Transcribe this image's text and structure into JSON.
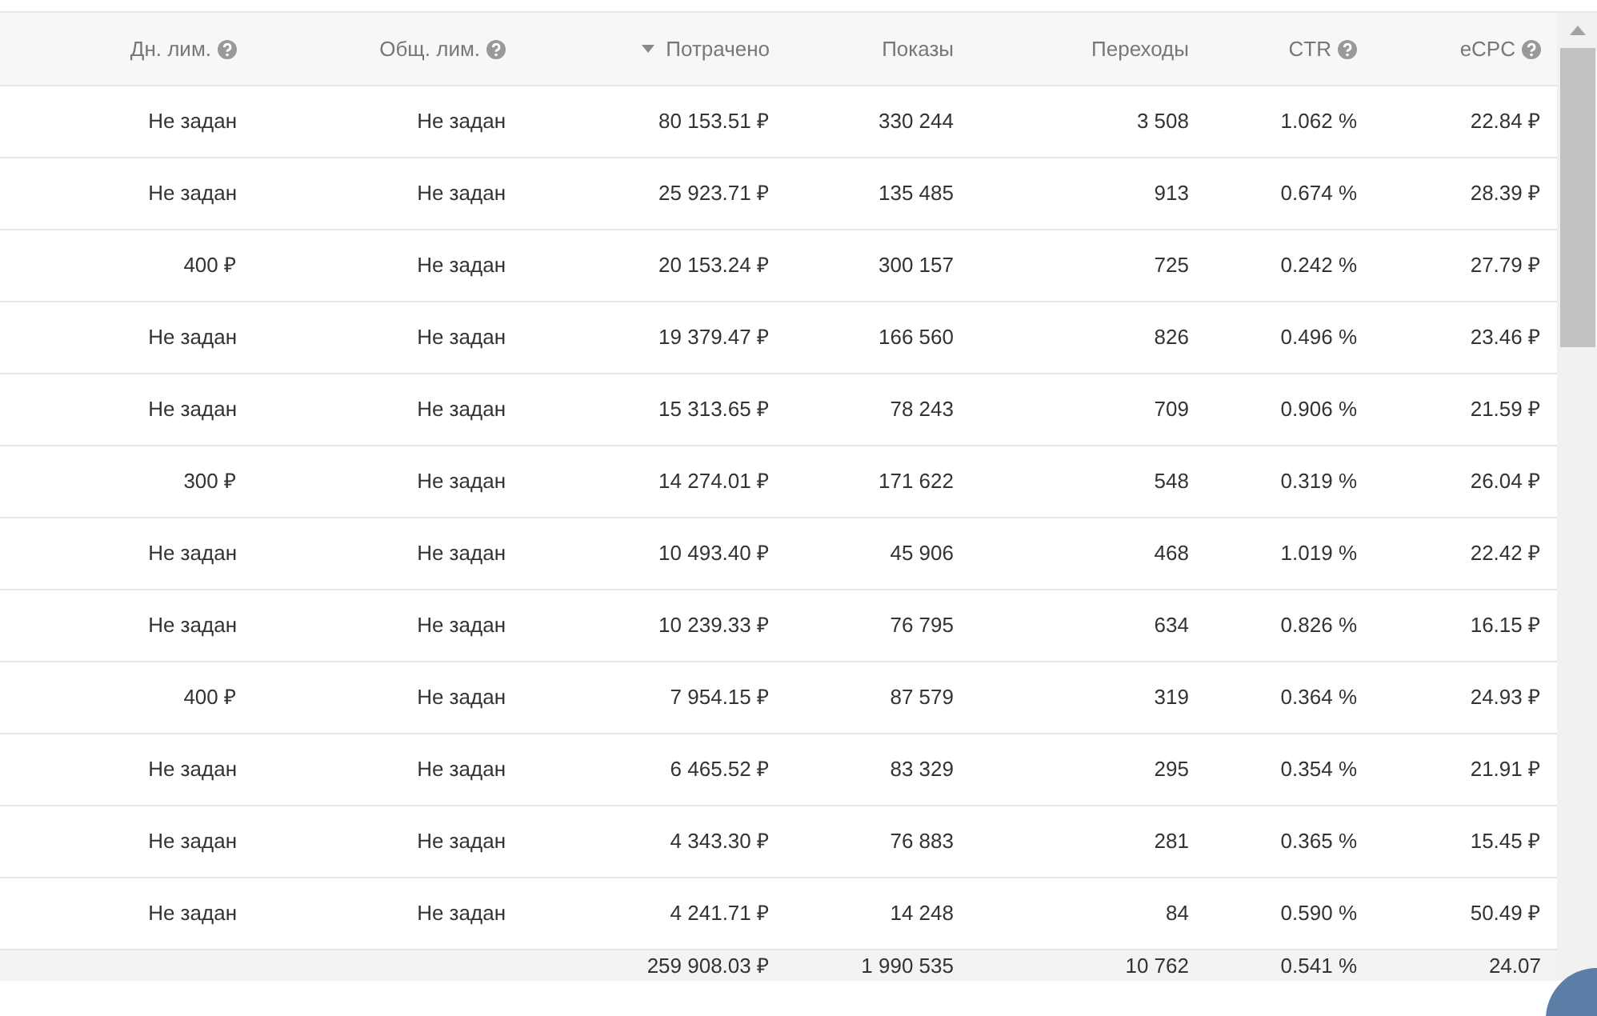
{
  "table": {
    "columns": [
      {
        "label": "Дн. лим.",
        "help": true,
        "sorted": false
      },
      {
        "label": "Общ. лим.",
        "help": true,
        "sorted": false
      },
      {
        "label": "Потрачено",
        "help": false,
        "sorted": true
      },
      {
        "label": "Показы",
        "help": false,
        "sorted": false
      },
      {
        "label": "Переходы",
        "help": false,
        "sorted": false
      },
      {
        "label": "CTR",
        "help": true,
        "sorted": false
      },
      {
        "label": "eCPC",
        "help": true,
        "sorted": false
      }
    ],
    "rows": [
      [
        "Не задан",
        "Не задан",
        "80 153.51 ₽",
        "330 244",
        "3 508",
        "1.062 %",
        "22.84 ₽"
      ],
      [
        "Не задан",
        "Не задан",
        "25 923.71 ₽",
        "135 485",
        "913",
        "0.674 %",
        "28.39 ₽"
      ],
      [
        "400 ₽",
        "Не задан",
        "20 153.24 ₽",
        "300 157",
        "725",
        "0.242 %",
        "27.79 ₽"
      ],
      [
        "Не задан",
        "Не задан",
        "19 379.47 ₽",
        "166 560",
        "826",
        "0.496 %",
        "23.46 ₽"
      ],
      [
        "Не задан",
        "Не задан",
        "15 313.65 ₽",
        "78 243",
        "709",
        "0.906 %",
        "21.59 ₽"
      ],
      [
        "300 ₽",
        "Не задан",
        "14 274.01 ₽",
        "171 622",
        "548",
        "0.319 %",
        "26.04 ₽"
      ],
      [
        "Не задан",
        "Не задан",
        "10 493.40 ₽",
        "45 906",
        "468",
        "1.019 %",
        "22.42 ₽"
      ],
      [
        "Не задан",
        "Не задан",
        "10 239.33 ₽",
        "76 795",
        "634",
        "0.826 %",
        "16.15 ₽"
      ],
      [
        "400 ₽",
        "Не задан",
        "7 954.15 ₽",
        "87 579",
        "319",
        "0.364 %",
        "24.93 ₽"
      ],
      [
        "Не задан",
        "Не задан",
        "6 465.52 ₽",
        "83 329",
        "295",
        "0.354 %",
        "21.91 ₽"
      ],
      [
        "Не задан",
        "Не задан",
        "4 343.30 ₽",
        "76 883",
        "281",
        "0.365 %",
        "15.45 ₽"
      ],
      [
        "Не задан",
        "Не задан",
        "4 241.71 ₽",
        "14 248",
        "84",
        "0.590 %",
        "50.49 ₽"
      ]
    ],
    "totals": [
      "259 908.03 ₽",
      "1 990 535",
      "10 762",
      "0.541 %",
      "24.07"
    ]
  }
}
